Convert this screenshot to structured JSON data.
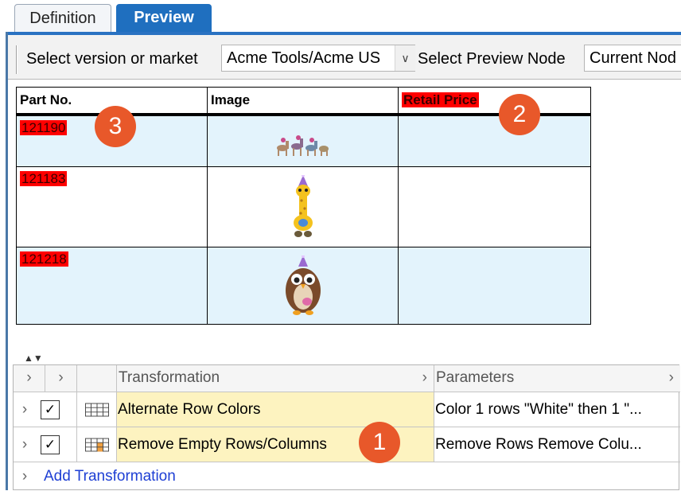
{
  "tabs": {
    "definition": "Definition",
    "preview": "Preview"
  },
  "toolbar": {
    "version_label": "Select version or market",
    "version_value": "Acme Tools/Acme US",
    "node_label": "Select Preview Node",
    "node_value": "Current Nod"
  },
  "preview_table": {
    "columns": [
      "Part No.",
      "Image",
      "Retail Price"
    ],
    "rows": [
      {
        "part_no": "121190",
        "image": "horses-icon",
        "retail_price": ""
      },
      {
        "part_no": "121183",
        "image": "giraffe-icon",
        "retail_price": ""
      },
      {
        "part_no": "121218",
        "image": "owl-icon",
        "retail_price": ""
      }
    ]
  },
  "callouts": [
    "1",
    "2",
    "3"
  ],
  "transformations": {
    "header": {
      "transformation": "Transformation",
      "parameters": "Parameters"
    },
    "rows": [
      {
        "name": "Alternate Row Colors",
        "params": "Color 1 rows \"White\" then 1 \"...",
        "checked": true
      },
      {
        "name": "Remove Empty Rows/Columns",
        "params": "Remove Rows Remove Colu...",
        "checked": true
      }
    ],
    "add_label": "Add Transformation"
  },
  "colors": {
    "highlight": "#ff0000",
    "callout": "#e8582a",
    "tab_active": "#1f6fbf",
    "alt_row": "#e3f3fc",
    "selected_cell": "#fdf3c0"
  }
}
